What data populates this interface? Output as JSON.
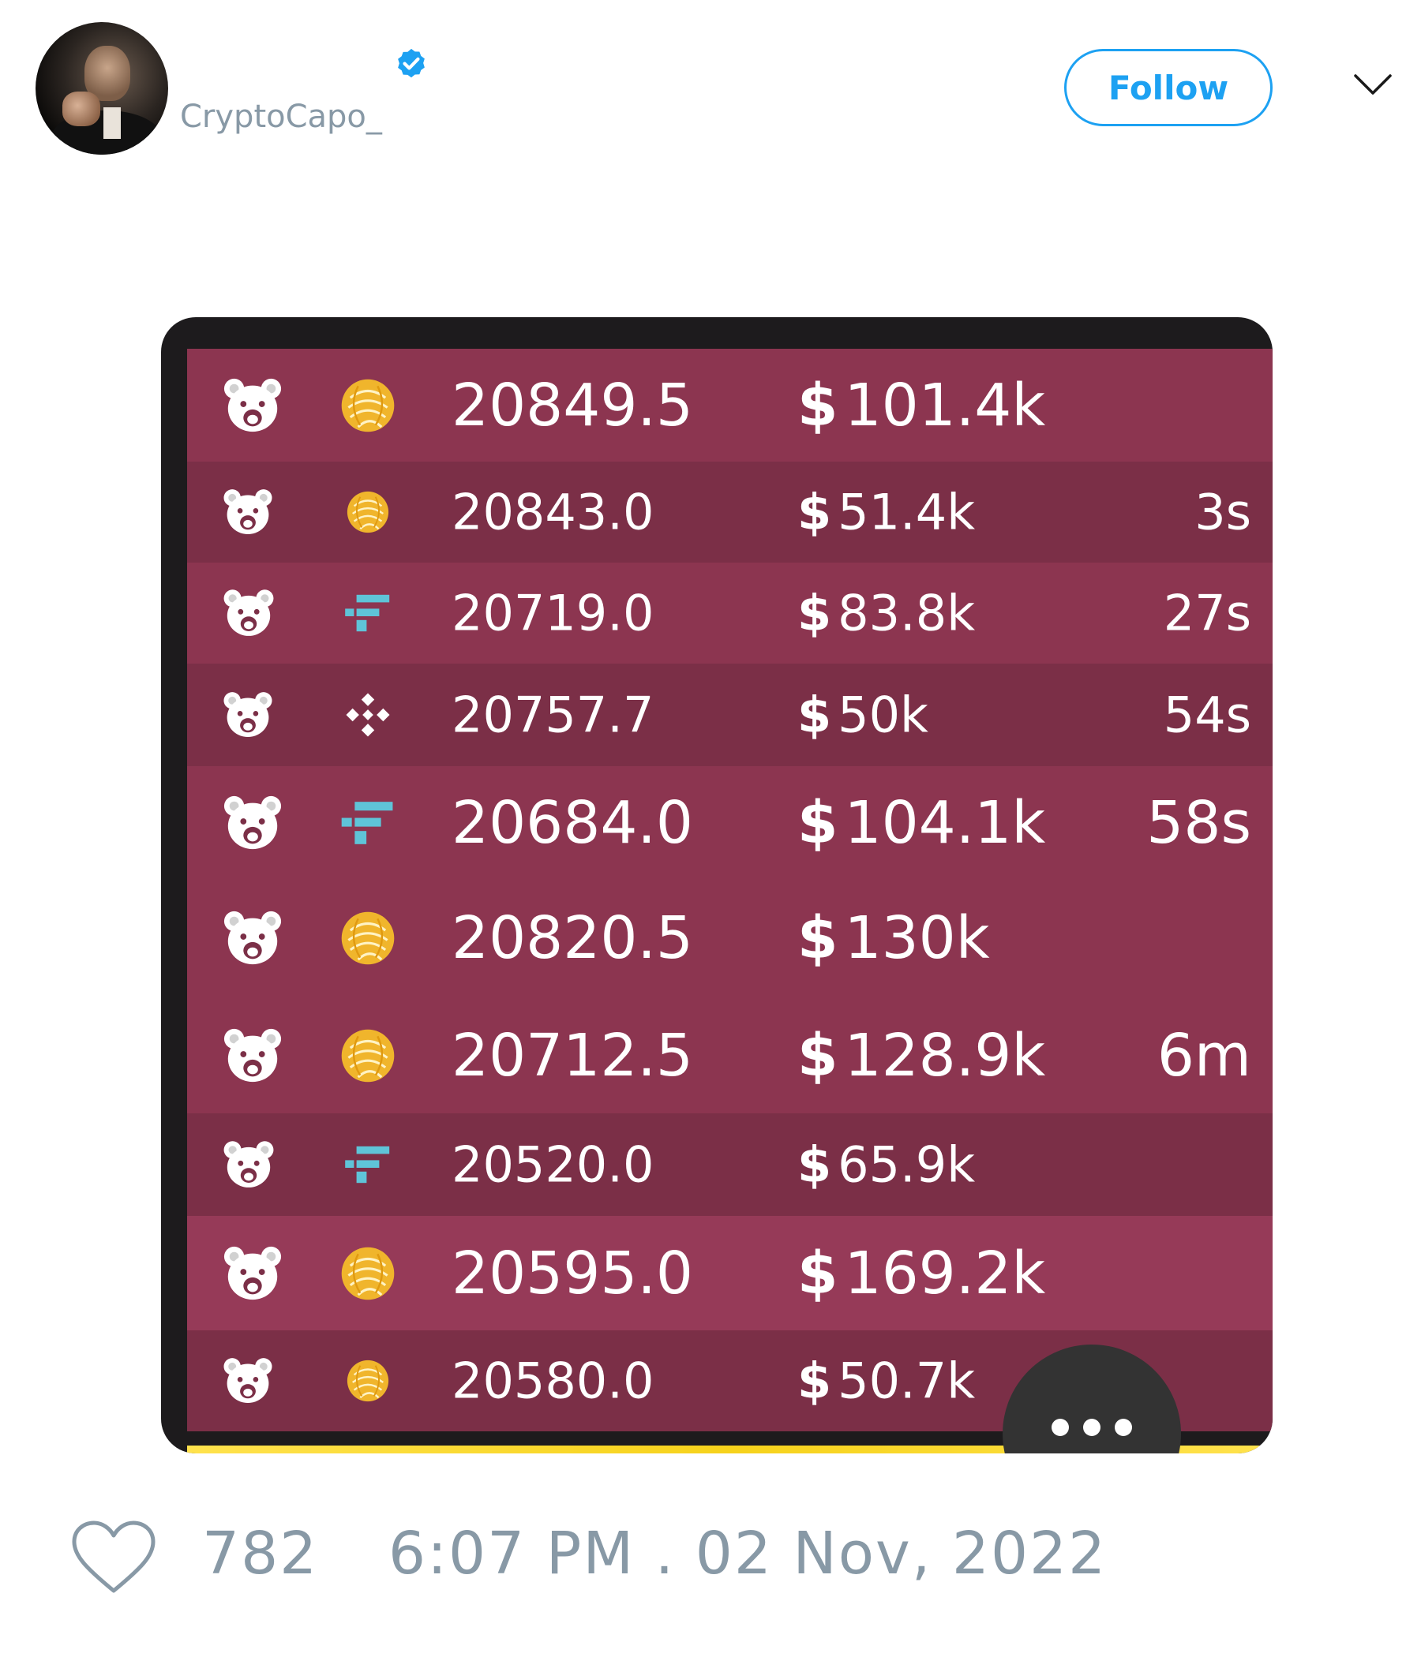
{
  "user": {
    "handle": "CryptoCapo_",
    "avatar_icon": "user-avatar",
    "verified_icon": "verified-badge-icon",
    "follow_label": "Follow",
    "menu_icon": "chevron-down-icon"
  },
  "trades": [
    {
      "side_icon": "bear-icon",
      "exchange_icon": "yellow-swirl-exchange-icon",
      "price": "20849.5",
      "amount": "101.4k",
      "age": "",
      "style": "light",
      "size": "big"
    },
    {
      "side_icon": "bear-icon",
      "exchange_icon": "yellow-swirl-exchange-icon",
      "price": "20843.0",
      "amount": "51.4k",
      "age": "3s",
      "style": "dark",
      "size": "small"
    },
    {
      "side_icon": "bear-icon",
      "exchange_icon": "ftx-icon",
      "price": "20719.0",
      "amount": "83.8k",
      "age": "27s",
      "style": "light",
      "size": "medium"
    },
    {
      "side_icon": "bear-icon",
      "exchange_icon": "binance-icon",
      "price": "20757.7",
      "amount": "50k",
      "age": "54s",
      "style": "dark",
      "size": "small"
    },
    {
      "side_icon": "bear-icon",
      "exchange_icon": "ftx-icon",
      "price": "20684.0",
      "amount": "104.1k",
      "age": "58s",
      "style": "light",
      "size": "big"
    },
    {
      "side_icon": "bear-icon",
      "exchange_icon": "yellow-swirl-exchange-icon",
      "price": "20820.5",
      "amount": "130k",
      "age": "",
      "style": "light",
      "size": "big"
    },
    {
      "side_icon": "bear-icon",
      "exchange_icon": "yellow-swirl-exchange-icon",
      "price": "20712.5",
      "amount": "128.9k",
      "age": "6m",
      "style": "light",
      "size": "big"
    },
    {
      "side_icon": "bear-icon",
      "exchange_icon": "ftx-icon",
      "price": "20520.0",
      "amount": "65.9k",
      "age": "",
      "style": "dark",
      "size": "medium"
    },
    {
      "side_icon": "bear-icon",
      "exchange_icon": "yellow-swirl-exchange-icon",
      "price": "20595.0",
      "amount": "169.2k",
      "age": "",
      "style": "pink",
      "size": "big"
    },
    {
      "side_icon": "bear-icon",
      "exchange_icon": "yellow-swirl-exchange-icon",
      "price": "20580.0",
      "amount": "50.7k",
      "age": "",
      "style": "dark",
      "size": "small"
    }
  ],
  "dollar_sign": "$",
  "more_button_icon": "more-dots-icon",
  "footer": {
    "like_icon": "heart-icon",
    "likes": "782",
    "timestamp": "6:07 PM . 02 Nov, 2022"
  },
  "colors": {
    "accent": "#1da1f2",
    "muted_text": "#8899a6",
    "row_light": "#8c3550",
    "row_dark": "#7b2f47",
    "row_pink": "#963a58",
    "coin_yellow": "#f0b52c",
    "ftx_cyan": "#5fc4d8",
    "progress_yellow": "#f6d21b"
  }
}
